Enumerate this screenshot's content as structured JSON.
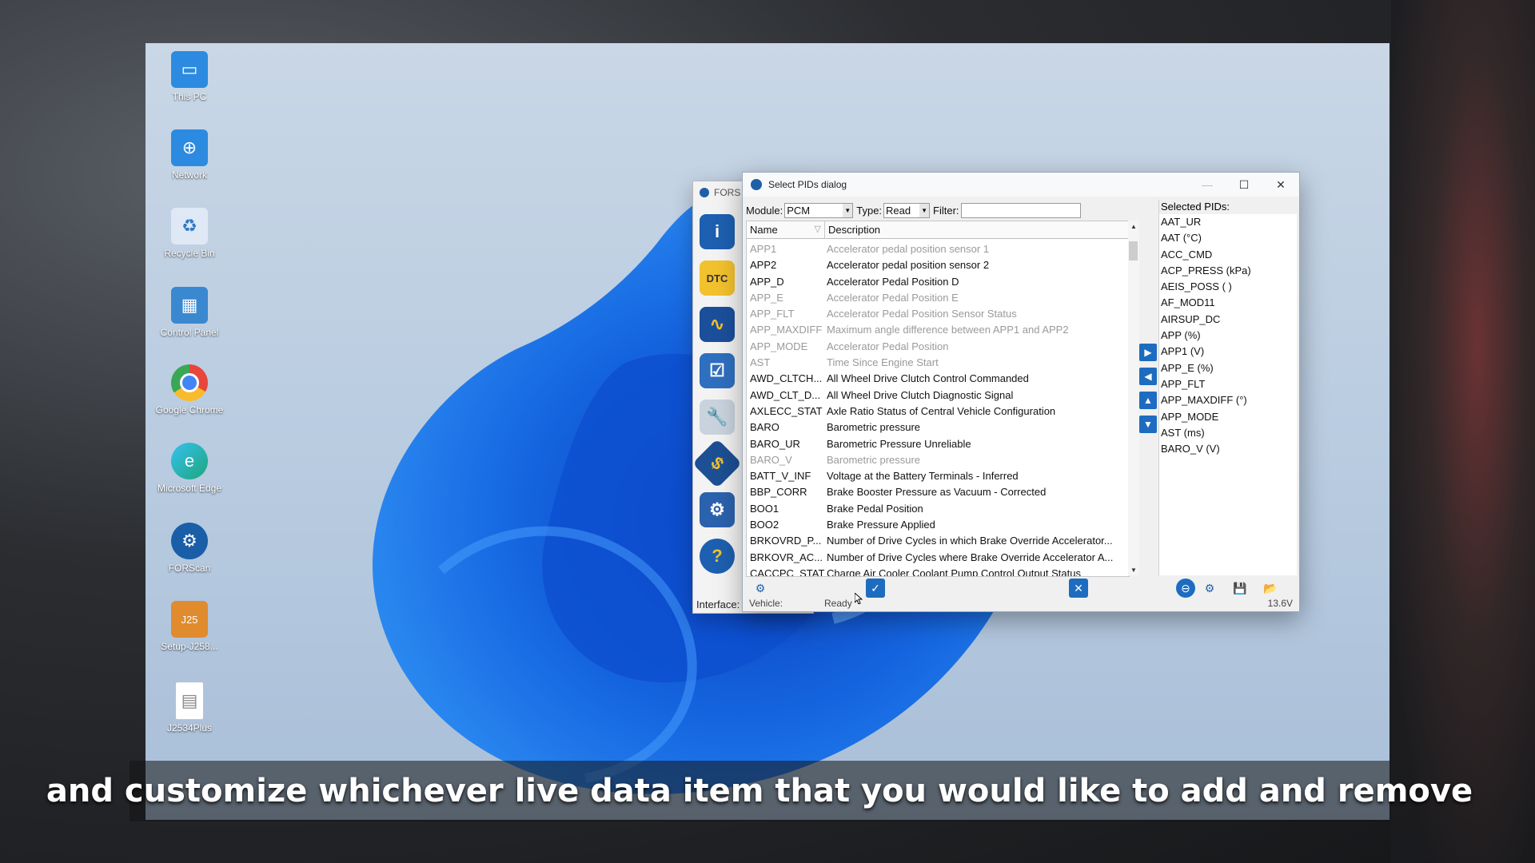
{
  "desktop_icons": [
    {
      "label": "This PC",
      "icon": "monitor-icon",
      "color": "#2c8be0"
    },
    {
      "label": "Network",
      "icon": "network-icon",
      "color": "#2c8be0"
    },
    {
      "label": "Recycle Bin",
      "icon": "recycle-bin-icon",
      "color": "#6aa0d8"
    },
    {
      "label": "Control Panel",
      "icon": "control-panel-icon",
      "color": "#3a88d0"
    },
    {
      "label": "Google Chrome",
      "icon": "chrome-icon",
      "color": "#e8453c"
    },
    {
      "label": "Microsoft Edge",
      "icon": "edge-icon",
      "color": "#1ea67a"
    },
    {
      "label": "FORScan",
      "icon": "forscan-icon",
      "color": "#1b5ea8"
    },
    {
      "label": "Setup-J258...",
      "icon": "installer-icon",
      "color": "#e08b2e"
    },
    {
      "label": "J2534Plus",
      "icon": "file-icon",
      "color": "#ffffff"
    }
  ],
  "forscan": {
    "title_fragment": "FORS",
    "interface_label": "Interface:",
    "vehicle_label": "Vehicle:",
    "ready_label": "Ready",
    "voltage": "13.6V"
  },
  "dialog": {
    "title": "Select PIDs dialog",
    "module_label": "Module:",
    "module_value": "PCM",
    "type_label": "Type:",
    "type_value": "Read",
    "filter_label": "Filter:",
    "filter_value": "",
    "col_name": "Name",
    "col_description": "Description",
    "rows": [
      {
        "name": "APP1",
        "desc": "Accelerator pedal position sensor 1",
        "disabled": true
      },
      {
        "name": "APP2",
        "desc": "Accelerator pedal position sensor 2",
        "disabled": false
      },
      {
        "name": "APP_D",
        "desc": "Accelerator Pedal Position D",
        "disabled": false
      },
      {
        "name": "APP_E",
        "desc": "Accelerator Pedal Position E",
        "disabled": true
      },
      {
        "name": "APP_FLT",
        "desc": "Accelerator Pedal Position Sensor Status",
        "disabled": true
      },
      {
        "name": "APP_MAXDIFF",
        "desc": "Maximum angle difference between APP1 and APP2",
        "disabled": true
      },
      {
        "name": "APP_MODE",
        "desc": "Accelerator Pedal Position",
        "disabled": true
      },
      {
        "name": "AST",
        "desc": "Time Since Engine Start",
        "disabled": true
      },
      {
        "name": "AWD_CLTCH...",
        "desc": "All Wheel Drive Clutch Control Commanded",
        "disabled": false
      },
      {
        "name": "AWD_CLT_D...",
        "desc": "All Wheel Drive Clutch Diagnostic Signal",
        "disabled": false
      },
      {
        "name": "AXLECC_STAT",
        "desc": "Axle Ratio Status of Central Vehicle Configuration",
        "disabled": false
      },
      {
        "name": "BARO",
        "desc": "Barometric pressure",
        "disabled": false
      },
      {
        "name": "BARO_UR",
        "desc": "Barometric Pressure Unreliable",
        "disabled": false
      },
      {
        "name": "BARO_V",
        "desc": "Barometric pressure",
        "disabled": true
      },
      {
        "name": "BATT_V_INF",
        "desc": "Voltage at the Battery Terminals - Inferred",
        "disabled": false
      },
      {
        "name": "BBP_CORR",
        "desc": "Brake Booster Pressure as Vacuum - Corrected",
        "disabled": false
      },
      {
        "name": "BOO1",
        "desc": "Brake Pedal Position",
        "disabled": false
      },
      {
        "name": "BOO2",
        "desc": "Brake Pressure Applied",
        "disabled": false
      },
      {
        "name": "BRKOVRD_P...",
        "desc": "Number of Drive Cycles in which Brake Override Accelerator...",
        "disabled": false
      },
      {
        "name": "BRKOVR_AC...",
        "desc": "Number of Drive Cycles where Brake Override Accelerator A...",
        "disabled": false
      },
      {
        "name": "CACCPC_STAT",
        "desc": "Charge Air Cooler Coolant Pump Control Output Status",
        "disabled": false
      }
    ],
    "selected_label": "Selected PIDs:",
    "selected": [
      "AAT_UR",
      "AAT (°C)",
      "ACC_CMD",
      "ACP_PRESS (kPa)",
      "AEIS_POSS ( )",
      "AF_MOD11",
      "AIRSUP_DC",
      "APP (%)",
      "APP1 (V)",
      "APP_E (%)",
      "APP_FLT",
      "APP_MAXDIFF (°)",
      "APP_MODE",
      "AST (ms)",
      "BARO_V (V)"
    ]
  },
  "caption": "and customize whichever live data item that you would like to add and remove",
  "accent": "#1d6cc0"
}
